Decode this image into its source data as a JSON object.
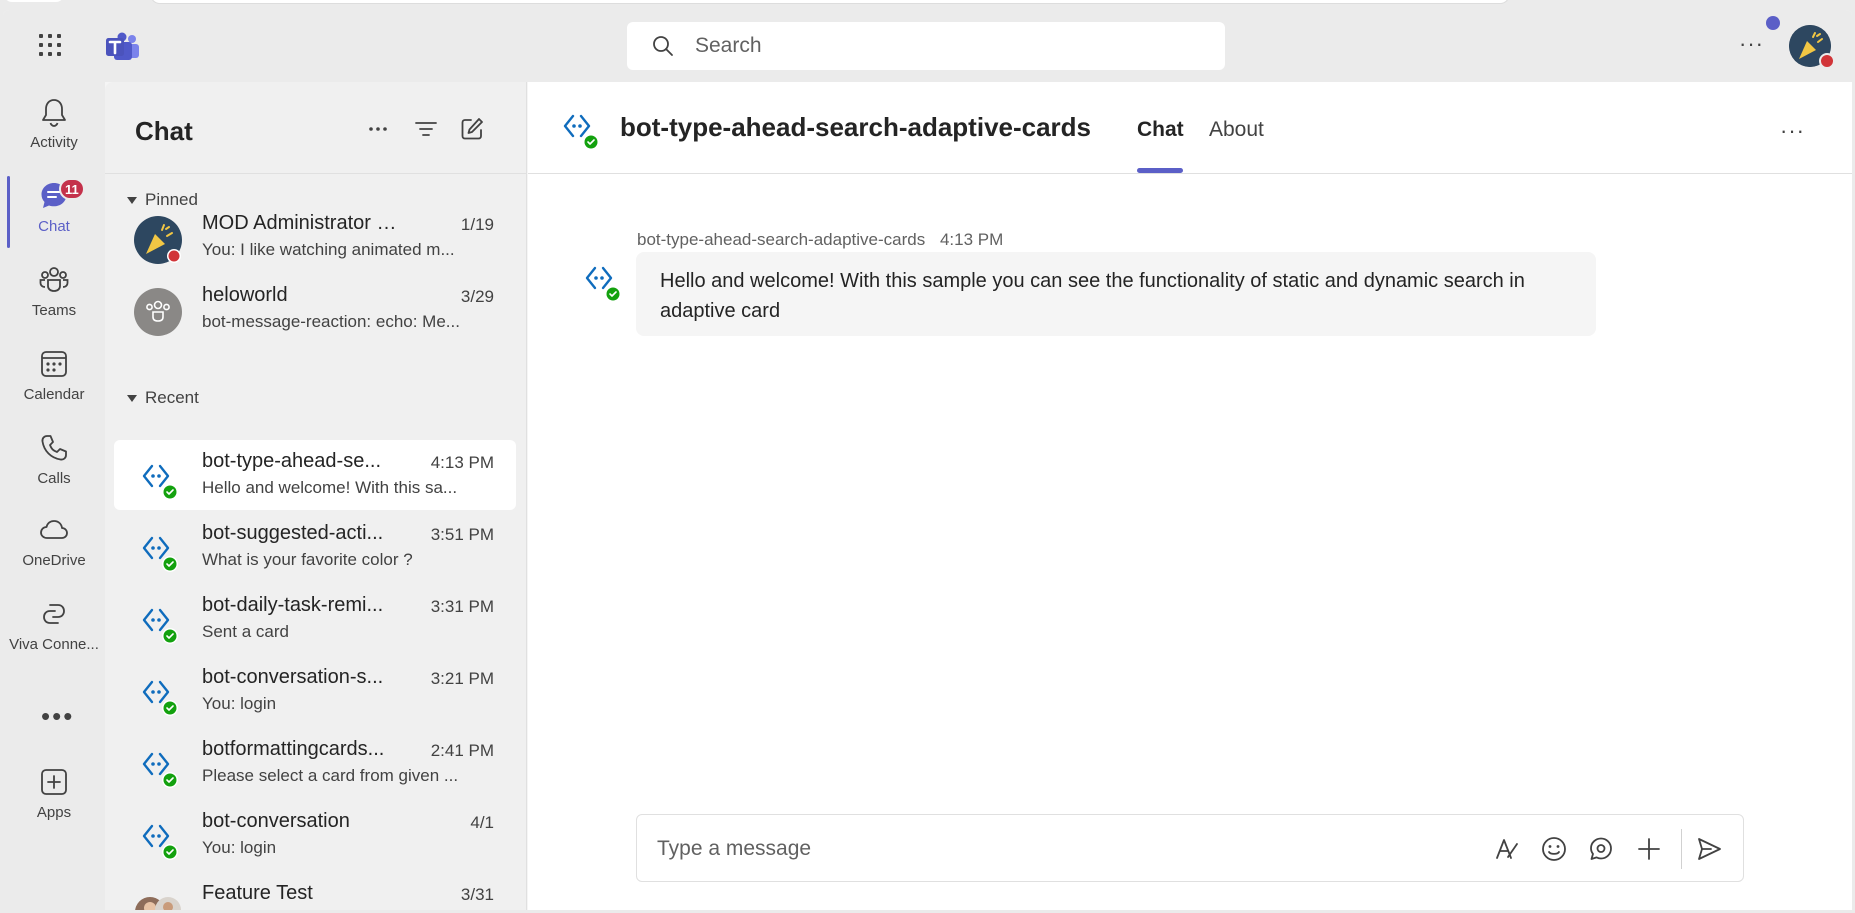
{
  "search": {
    "placeholder": "Search"
  },
  "titlebar": {
    "more_label": "···"
  },
  "rail": {
    "items": [
      {
        "label": "Activity",
        "icon": "bell-icon"
      },
      {
        "label": "Chat",
        "icon": "chat-icon",
        "badge": "11"
      },
      {
        "label": "Teams",
        "icon": "teams-icon"
      },
      {
        "label": "Calendar",
        "icon": "calendar-icon"
      },
      {
        "label": "Calls",
        "icon": "phone-icon"
      },
      {
        "label": "OneDrive",
        "icon": "cloud-icon"
      },
      {
        "label": "Viva Conne...",
        "icon": "viva-connections-icon"
      },
      {
        "label": "Apps",
        "icon": "add-app-icon"
      }
    ],
    "more_label": "•••"
  },
  "chatlist": {
    "title": "Chat",
    "sections": {
      "pinned": "Pinned",
      "recent": "Recent"
    },
    "pinned": [
      {
        "name": "MOD Administrator (Y...",
        "time": "1/19",
        "preview": "You: I like watching animated m..."
      },
      {
        "name": "heloworld",
        "time": "3/29",
        "preview": "bot-message-reaction: echo: Me..."
      }
    ],
    "recent": [
      {
        "name": "bot-type-ahead-se...",
        "time": "4:13 PM",
        "preview": "Hello and welcome! With this sa..."
      },
      {
        "name": "bot-suggested-acti...",
        "time": "3:51 PM",
        "preview": "What is your favorite color ?"
      },
      {
        "name": "bot-daily-task-remi...",
        "time": "3:31 PM",
        "preview": "Sent a card"
      },
      {
        "name": "bot-conversation-s...",
        "time": "3:21 PM",
        "preview": "You: login"
      },
      {
        "name": "botformattingcards...",
        "time": "2:41 PM",
        "preview": "Please select a card from given ..."
      },
      {
        "name": "bot-conversation",
        "time": "4/1",
        "preview": "You: login"
      },
      {
        "name": "Feature Test",
        "time": "3/31",
        "preview": ""
      }
    ]
  },
  "main": {
    "title": "bot-type-ahead-search-adaptive-cards",
    "tabs": [
      {
        "label": "Chat"
      },
      {
        "label": "About"
      }
    ],
    "message": {
      "sender": "bot-type-ahead-search-adaptive-cards",
      "time": "4:13 PM",
      "text": "Hello and welcome! With this sample you can see the functionality of static and dynamic search in adaptive card"
    },
    "composer": {
      "placeholder": "Type a message"
    }
  },
  "colors": {
    "accent": "#5b5fc7",
    "online": "#13a10e",
    "busy": "#d13438",
    "badge": "#c4314b",
    "bot_blue": "#0f6cbd"
  }
}
